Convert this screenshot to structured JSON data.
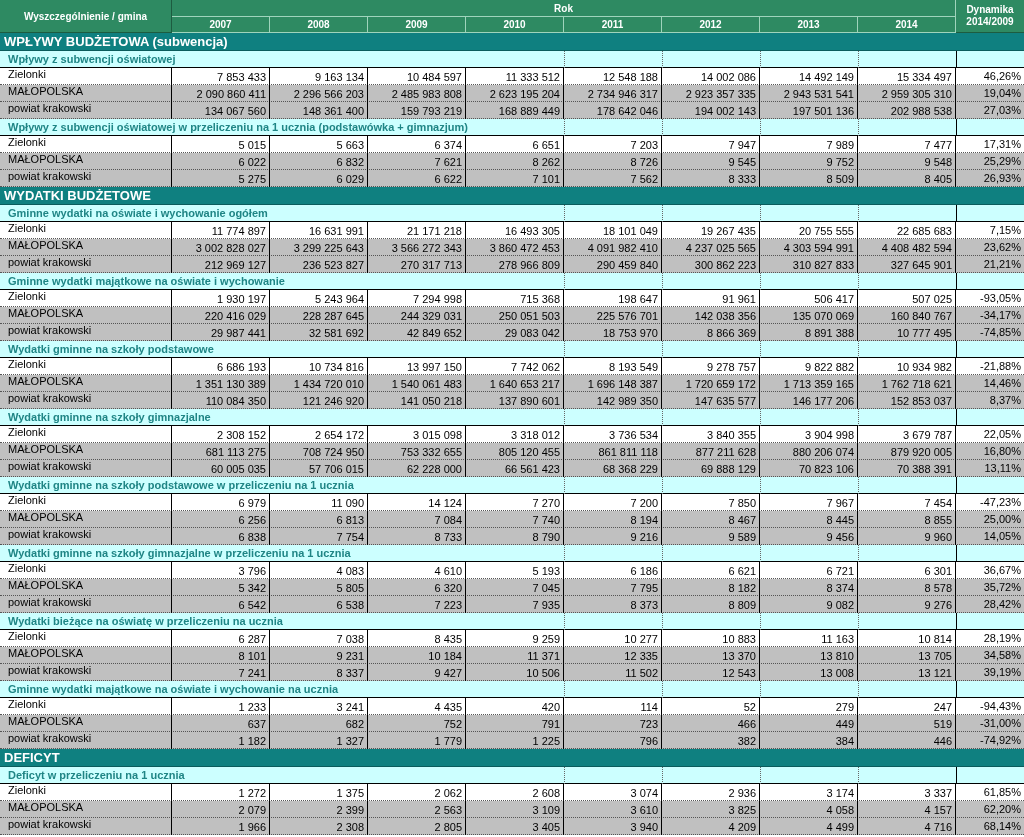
{
  "table": {
    "header": {
      "label_column": "Wyszczególnienie / gmina",
      "group": "Rok",
      "years": [
        "2007",
        "2008",
        "2009",
        "2010",
        "2011",
        "2012",
        "2013",
        "2014"
      ],
      "dynamics": "Dynamika 2014/2009"
    },
    "sections": [
      {
        "title": "WPŁYWY BUDŻETOWA (subwencja)",
        "groups": [
          {
            "title": "Wpływy z subwencji oświatowej",
            "rows": [
              {
                "label": "Zielonki",
                "values": [
                  "7 853 433",
                  "9 163 134",
                  "10 484 597",
                  "11 333 512",
                  "12 548 188",
                  "14 002 086",
                  "14 492 149",
                  "15 334 497"
                ],
                "dynamics": "46,26%"
              },
              {
                "label": "MAŁOPOLSKA",
                "values": [
                  "2 090 860 411",
                  "2 296 566 203",
                  "2 485 983 808",
                  "2 623 195 204",
                  "2 734 946 317",
                  "2 923 357 335",
                  "2 943 531 541",
                  "2 959 305 310"
                ],
                "dynamics": "19,04%"
              },
              {
                "label": "powiat krakowski",
                "values": [
                  "134 067 560",
                  "148 361 400",
                  "159 793 219",
                  "168 889 449",
                  "178 642 046",
                  "194 002 143",
                  "197 501 136",
                  "202 988 538"
                ],
                "dynamics": "27,03%"
              }
            ]
          },
          {
            "title": "Wpływy z subwencji oświatowej w przeliczeniu na 1 ucznia (podstawówka + gimnazjum)",
            "rows": [
              {
                "label": "Zielonki",
                "values": [
                  "5 015",
                  "5 663",
                  "6 374",
                  "6 651",
                  "7 203",
                  "7 947",
                  "7 989",
                  "7 477"
                ],
                "dynamics": "17,31%"
              },
              {
                "label": "MAŁOPOLSKA",
                "values": [
                  "6 022",
                  "6 832",
                  "7 621",
                  "8 262",
                  "8 726",
                  "9 545",
                  "9 752",
                  "9 548"
                ],
                "dynamics": "25,29%"
              },
              {
                "label": "powiat krakowski",
                "values": [
                  "5 275",
                  "6 029",
                  "6 622",
                  "7 101",
                  "7 562",
                  "8 333",
                  "8 509",
                  "8 405"
                ],
                "dynamics": "26,93%"
              }
            ]
          }
        ]
      },
      {
        "title": "WYDATKI BUDŻETOWE",
        "groups": [
          {
            "title": "Gminne wydatki na oświate i wychowanie ogółem",
            "rows": [
              {
                "label": "Zielonki",
                "values": [
                  "11 774 897",
                  "16 631 991",
                  "21 171 218",
                  "16 493 305",
                  "18 101 049",
                  "19 267 435",
                  "20 755 555",
                  "22 685 683"
                ],
                "dynamics": "7,15%"
              },
              {
                "label": "MAŁOPOLSKA",
                "values": [
                  "3 002 828 027",
                  "3 299 225 643",
                  "3 566 272 343",
                  "3 860 472 453",
                  "4 091 982 410",
                  "4 237 025 565",
                  "4 303 594 991",
                  "4 408 482 594"
                ],
                "dynamics": "23,62%"
              },
              {
                "label": "powiat krakowski",
                "values": [
                  "212 969 127",
                  "236 523 827",
                  "270 317 713",
                  "278 966 809",
                  "290 459 840",
                  "300 862 223",
                  "310 827 833",
                  "327 645 901"
                ],
                "dynamics": "21,21%"
              }
            ]
          },
          {
            "title": "Gminne wydatki majątkowe na oświate i wychowanie",
            "rows": [
              {
                "label": "Zielonki",
                "values": [
                  "1 930 197",
                  "5 243 964",
                  "7 294 998",
                  "715 368",
                  "198 647",
                  "91 961",
                  "506 417",
                  "507 025"
                ],
                "dynamics": "-93,05%"
              },
              {
                "label": "MAŁOPOLSKA",
                "values": [
                  "220 416 029",
                  "228 287 645",
                  "244 329 031",
                  "250 051 503",
                  "225 576 701",
                  "142 038 356",
                  "135 070 069",
                  "160 840 767"
                ],
                "dynamics": "-34,17%"
              },
              {
                "label": "powiat krakowski",
                "values": [
                  "29 987 441",
                  "32 581 692",
                  "42 849 652",
                  "29 083 042",
                  "18 753 970",
                  "8 866 369",
                  "8 891 388",
                  "10 777 495"
                ],
                "dynamics": "-74,85%"
              }
            ]
          },
          {
            "title": "Wydatki gminne na szkoły podstawowe",
            "rows": [
              {
                "label": "Zielonki",
                "values": [
                  "6 686 193",
                  "10 734 816",
                  "13 997 150",
                  "7 742 062",
                  "8 193 549",
                  "9 278 757",
                  "9 822 882",
                  "10 934 982"
                ],
                "dynamics": "-21,88%"
              },
              {
                "label": "MAŁOPOLSKA",
                "values": [
                  "1 351 130 389",
                  "1 434 720 010",
                  "1 540 061 483",
                  "1 640 653 217",
                  "1 696 148 387",
                  "1 720 659 172",
                  "1 713 359 165",
                  "1 762 718 621"
                ],
                "dynamics": "14,46%"
              },
              {
                "label": "powiat krakowski",
                "values": [
                  "110 084 350",
                  "121 246 920",
                  "141 050 218",
                  "137 890 601",
                  "142 989 350",
                  "147 635 577",
                  "146 177 206",
                  "152 853 037"
                ],
                "dynamics": "8,37%"
              }
            ]
          },
          {
            "title": "Wydatki gminne na szkoły gimnazjalne",
            "rows": [
              {
                "label": "Zielonki",
                "values": [
                  "2 308 152",
                  "2 654 172",
                  "3 015 098",
                  "3 318 012",
                  "3 736 534",
                  "3 840 355",
                  "3 904 998",
                  "3 679 787"
                ],
                "dynamics": "22,05%"
              },
              {
                "label": "MAŁOPOLSKA",
                "values": [
                  "681 113 275",
                  "708 724 950",
                  "753 332 655",
                  "805 120 455",
                  "861 811 118",
                  "877 211 628",
                  "880 206 074",
                  "879 920 005"
                ],
                "dynamics": "16,80%"
              },
              {
                "label": "powiat krakowski",
                "values": [
                  "60 005 035",
                  "57 706 015",
                  "62 228 000",
                  "66 561 423",
                  "68 368 229",
                  "69 888 129",
                  "70 823 106",
                  "70 388 391"
                ],
                "dynamics": "13,11%"
              }
            ]
          },
          {
            "title": "Wydatki gminne na szkoły podstawowe w przeliczeniu na 1 ucznia",
            "rows": [
              {
                "label": "Zielonki",
                "values": [
                  "6 979",
                  "11 090",
                  "14 124",
                  "7 270",
                  "7 200",
                  "7 850",
                  "7 967",
                  "7 454"
                ],
                "dynamics": "-47,23%"
              },
              {
                "label": "MAŁOPOLSKA",
                "values": [
                  "6 256",
                  "6 813",
                  "7 084",
                  "7 740",
                  "8 194",
                  "8 467",
                  "8 445",
                  "8 855"
                ],
                "dynamics": "25,00%"
              },
              {
                "label": "powiat krakowski",
                "values": [
                  "6 838",
                  "7 754",
                  "8 733",
                  "8 790",
                  "9 216",
                  "9 589",
                  "9 456",
                  "9 960"
                ],
                "dynamics": "14,05%"
              }
            ]
          },
          {
            "title": "Wydatki gminne na szkoły gimnazjalne w przeliczeniu na 1 ucznia",
            "rows": [
              {
                "label": "Zielonki",
                "values": [
                  "3 796",
                  "4 083",
                  "4 610",
                  "5 193",
                  "6 186",
                  "6 621",
                  "6 721",
                  "6 301"
                ],
                "dynamics": "36,67%"
              },
              {
                "label": "MAŁOPOLSKA",
                "values": [
                  "5 342",
                  "5 805",
                  "6 320",
                  "7 045",
                  "7 795",
                  "8 182",
                  "8 374",
                  "8 578"
                ],
                "dynamics": "35,72%"
              },
              {
                "label": "powiat krakowski",
                "values": [
                  "6 542",
                  "6 538",
                  "7 223",
                  "7 935",
                  "8 373",
                  "8 809",
                  "9 082",
                  "9 276"
                ],
                "dynamics": "28,42%"
              }
            ]
          },
          {
            "title": "Wydatki bieżące na oświatę w przeliczeniu na ucznia",
            "rows": [
              {
                "label": "Zielonki",
                "values": [
                  "6 287",
                  "7 038",
                  "8 435",
                  "9 259",
                  "10 277",
                  "10 883",
                  "11 163",
                  "10 814"
                ],
                "dynamics": "28,19%"
              },
              {
                "label": "MAŁOPOLSKA",
                "values": [
                  "8 101",
                  "9 231",
                  "10 184",
                  "11 371",
                  "12 335",
                  "13 370",
                  "13 810",
                  "13 705"
                ],
                "dynamics": "34,58%"
              },
              {
                "label": "powiat krakowski",
                "values": [
                  "7 241",
                  "8 337",
                  "9 427",
                  "10 506",
                  "11 502",
                  "12 543",
                  "13 008",
                  "13 121"
                ],
                "dynamics": "39,19%"
              }
            ]
          },
          {
            "title": "Gminne wydatki majątkowe na oświate i wychowanie na ucznia",
            "rows": [
              {
                "label": "Zielonki",
                "values": [
                  "1 233",
                  "3 241",
                  "4 435",
                  "420",
                  "114",
                  "52",
                  "279",
                  "247"
                ],
                "dynamics": "-94,43%"
              },
              {
                "label": "MAŁOPOLSKA",
                "values": [
                  "637",
                  "682",
                  "752",
                  "791",
                  "723",
                  "466",
                  "449",
                  "519"
                ],
                "dynamics": "-31,00%"
              },
              {
                "label": "powiat krakowski",
                "values": [
                  "1 182",
                  "1 327",
                  "1 779",
                  "1 225",
                  "796",
                  "382",
                  "384",
                  "446"
                ],
                "dynamics": "-74,92%"
              }
            ]
          }
        ]
      },
      {
        "title": "DEFICYT",
        "groups": [
          {
            "title": "Deficyt w przeliczeniu na 1 ucznia",
            "rows": [
              {
                "label": "Zielonki",
                "values": [
                  "1 272",
                  "1 375",
                  "2 062",
                  "2 608",
                  "3 074",
                  "2 936",
                  "3 174",
                  "3 337"
                ],
                "dynamics": "61,85%"
              },
              {
                "label": "MAŁOPOLSKA",
                "values": [
                  "2 079",
                  "2 399",
                  "2 563",
                  "3 109",
                  "3 610",
                  "3 825",
                  "4 058",
                  "4 157"
                ],
                "dynamics": "62,20%"
              },
              {
                "label": "powiat krakowski",
                "values": [
                  "1 966",
                  "2 308",
                  "2 805",
                  "3 405",
                  "3 940",
                  "4 209",
                  "4 499",
                  "4 716"
                ],
                "dynamics": "68,14%"
              }
            ]
          }
        ]
      }
    ]
  }
}
